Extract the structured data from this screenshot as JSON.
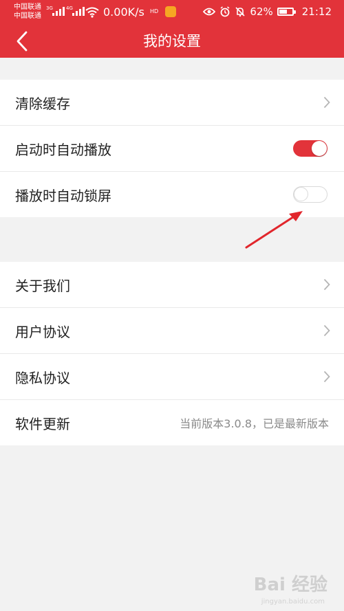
{
  "statusbar": {
    "carrier_1": "中国联通",
    "carrier_2": "中国联通",
    "net_1": "3G",
    "net_2": "4G",
    "speed": "0.00K/s",
    "hd": "HD",
    "battery_percent": "62%",
    "battery_level": 62,
    "time": "21:12"
  },
  "navbar": {
    "title": "我的设置"
  },
  "settings_group_1": [
    {
      "label": "清除缓存",
      "type": "link"
    },
    {
      "label": "启动时自动播放",
      "type": "toggle",
      "enabled": true
    },
    {
      "label": "播放时自动锁屏",
      "type": "toggle",
      "enabled": false
    }
  ],
  "settings_group_2": [
    {
      "label": "关于我们",
      "type": "link"
    },
    {
      "label": "用户协议",
      "type": "link"
    },
    {
      "label": "隐私协议",
      "type": "link"
    },
    {
      "label": "软件更新",
      "type": "info",
      "value": "当前版本3.0.8，已是最新版本"
    }
  ],
  "watermark": {
    "brand": "Bai 经验",
    "url": "jingyan.baidu.com"
  },
  "colors": {
    "accent": "#e2333a",
    "annotation_arrow": "#e1262c"
  },
  "icons": [
    "back-arrow-icon",
    "chevron-right-icon",
    "wifi-icon",
    "eye-icon",
    "alarm-icon",
    "bell-off-icon",
    "battery-icon"
  ]
}
